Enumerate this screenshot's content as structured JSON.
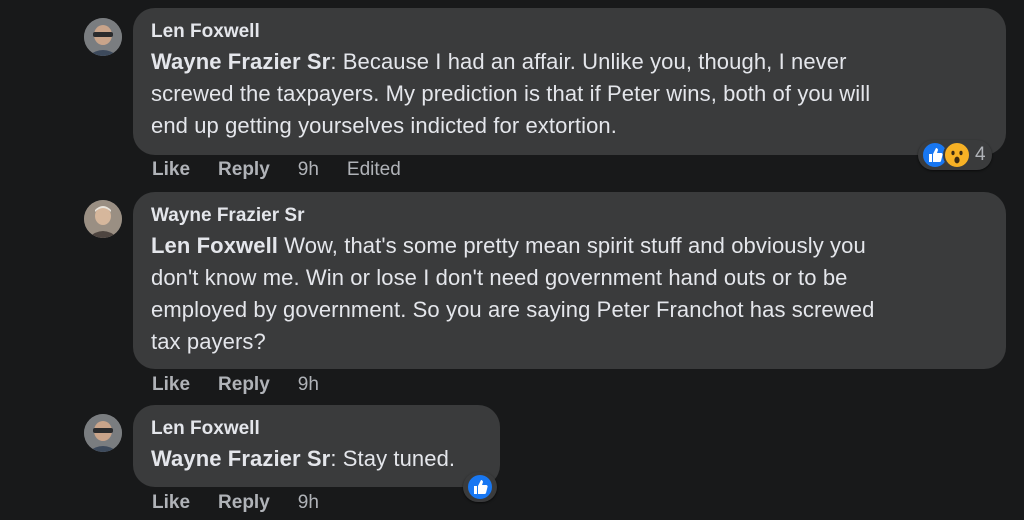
{
  "comments": [
    {
      "author": "Len Foxwell",
      "mention": "Wayne Frazier Sr",
      "separator": ":",
      "lines": [
        " Because I had an affair. Unlike you, though, I never",
        "screwed the taxpayers. My prediction is that if Peter wins, both of you will",
        "end up getting yourselves indicted for extortion."
      ],
      "actions": {
        "like": "Like",
        "reply": "Reply",
        "time": "9h",
        "edited": "Edited"
      },
      "reactions": {
        "icons": [
          "like-icon",
          "wow-icon"
        ],
        "count": "4"
      }
    },
    {
      "author": "Wayne Frazier Sr",
      "mention": "Len Foxwell",
      "separator": "",
      "lines": [
        " Wow, that's some pretty mean spirit stuff and obviously you",
        "don't know me. Win or lose I don't need government hand outs or to be",
        "employed by government. So you are saying Peter Franchot has screwed",
        "tax payers?"
      ],
      "actions": {
        "like": "Like",
        "reply": "Reply",
        "time": "9h"
      }
    },
    {
      "author": "Len Foxwell",
      "mention": "Wayne Frazier Sr",
      "separator": ":",
      "lines": [
        " Stay tuned."
      ],
      "actions": {
        "like": "Like",
        "reply": "Reply",
        "time": "9h"
      },
      "reactions": {
        "icons": [
          "like-icon"
        ]
      }
    }
  ],
  "colors": {
    "background": "#18191a",
    "bubble": "#3a3b3c",
    "text": "#e4e6eb",
    "secondary": "#b0b3b8",
    "like_blue": "#1877f2",
    "wow_yellow": "#f7b125"
  }
}
